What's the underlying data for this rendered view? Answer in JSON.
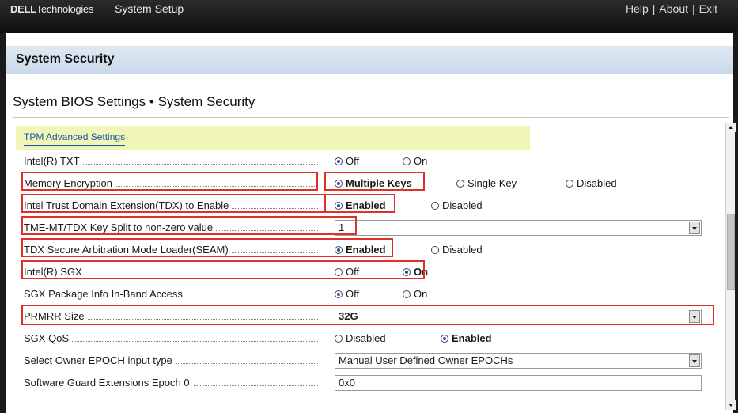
{
  "header": {
    "logo_brand": "DELL",
    "logo_suffix": "Technologies",
    "app_title": "System Setup",
    "links": [
      "Help",
      "About",
      "Exit"
    ]
  },
  "section_title": "System Security",
  "page_title": "System BIOS Settings • System Security",
  "group_header": "TPM Advanced Settings",
  "rows": [
    {
      "label": "Intel(R) TXT",
      "type": "radio",
      "options": [
        "Off",
        "On"
      ],
      "selected": "Off"
    },
    {
      "label": "Memory Encryption",
      "type": "radio",
      "options": [
        "Multiple Keys",
        "Single Key",
        "Disabled"
      ],
      "selected": "Multiple Keys"
    },
    {
      "label": "Intel Trust Domain Extension(TDX) to Enable",
      "type": "radio",
      "options": [
        "Enabled",
        "Disabled"
      ],
      "selected": "Enabled"
    },
    {
      "label": "TME-MT/TDX Key Split to non-zero value",
      "type": "select",
      "value": "1"
    },
    {
      "label": "TDX Secure Arbitration Mode Loader(SEAM)",
      "type": "radio",
      "options": [
        "Enabled",
        "Disabled"
      ],
      "selected": "Enabled"
    },
    {
      "label": "Intel(R) SGX",
      "type": "radio",
      "options": [
        "Off",
        "On"
      ],
      "selected": "On"
    },
    {
      "label": "SGX Package Info In-Band Access",
      "type": "radio",
      "options": [
        "Off",
        "On"
      ],
      "selected": "Off"
    },
    {
      "label": "PRMRR Size",
      "type": "select",
      "value": "32G"
    },
    {
      "label": "SGX QoS",
      "type": "radio",
      "options": [
        "Disabled",
        "Enabled"
      ],
      "selected": "Enabled"
    },
    {
      "label": "Select Owner EPOCH input type",
      "type": "select",
      "value": "Manual User Defined Owner EPOCHs"
    },
    {
      "label": "Software Guard Extensions Epoch 0",
      "type": "text",
      "value": "0x0"
    }
  ],
  "colors": {
    "highlight": "#e0302a",
    "group_header_bg": "#f0f5b8",
    "link": "#1b57a8",
    "section_bar": "#c9d9e9"
  }
}
